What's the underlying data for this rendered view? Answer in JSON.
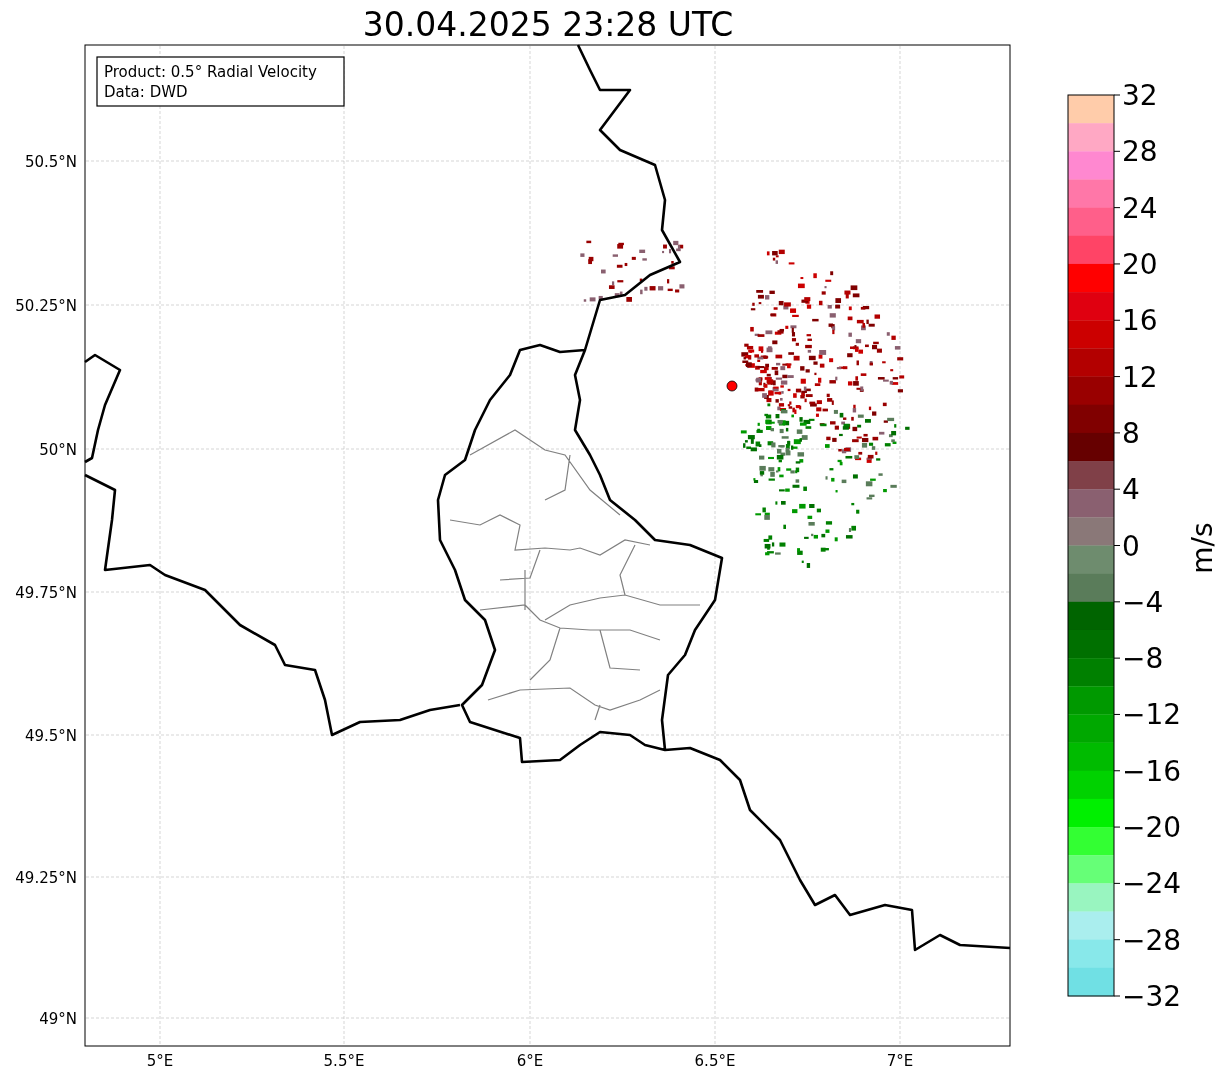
{
  "title": "30.04.2025 23:28 UTC",
  "legend": [
    "Product: 0.5° Radial Velocity",
    "Data: DWD"
  ],
  "map": {
    "lat_labels": [
      "50.5°N",
      "50.25°N",
      "50°N",
      "49.75°N",
      "49.5°N",
      "49.25°N",
      "49°N"
    ],
    "lon_labels": [
      "5°E",
      "5.5°E",
      "6°E",
      "6.5°E",
      "7°E"
    ]
  },
  "colorbar": {
    "label": "m/s",
    "ticks": [
      "32",
      "28",
      "24",
      "20",
      "16",
      "12",
      "8",
      "4",
      "0",
      "−4",
      "−8",
      "−12",
      "−16",
      "−20",
      "−24",
      "−28",
      "−32"
    ],
    "segments": [
      {
        "color": "#ffccaa"
      },
      {
        "color": "#ffa8c4"
      },
      {
        "color": "#ff88d0"
      },
      {
        "color": "#ff77a8"
      },
      {
        "color": "#ff5f8a"
      },
      {
        "color": "#ff4466"
      },
      {
        "color": "#ff0000"
      },
      {
        "color": "#e00010"
      },
      {
        "color": "#cc0000"
      },
      {
        "color": "#b30000"
      },
      {
        "color": "#990000"
      },
      {
        "color": "#800000"
      },
      {
        "color": "#660000"
      },
      {
        "color": "#804048"
      },
      {
        "color": "#8a6070"
      },
      {
        "color": "#8a7878"
      },
      {
        "color": "#6e8c6e"
      },
      {
        "color": "#5a7c5a"
      },
      {
        "color": "#006400"
      },
      {
        "color": "#007000"
      },
      {
        "color": "#008000"
      },
      {
        "color": "#009900"
      },
      {
        "color": "#00a800"
      },
      {
        "color": "#00bb00"
      },
      {
        "color": "#00d200"
      },
      {
        "color": "#00f000"
      },
      {
        "color": "#33ff33"
      },
      {
        "color": "#66ff77"
      },
      {
        "color": "#99f5c0"
      },
      {
        "color": "#aaeeee"
      },
      {
        "color": "#88e8ea"
      },
      {
        "color": "#70e0e4"
      }
    ]
  }
}
